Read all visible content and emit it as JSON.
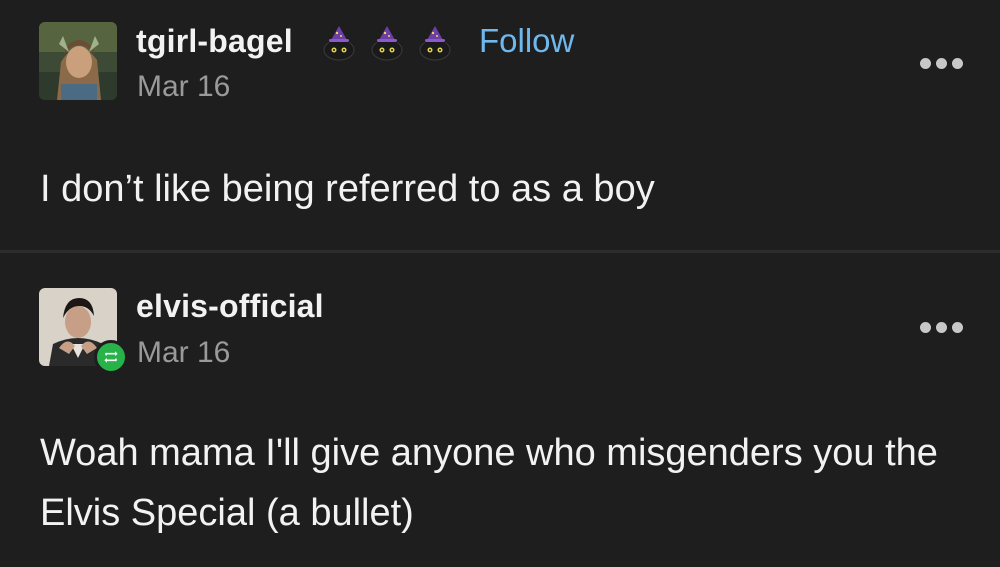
{
  "posts": [
    {
      "username": "tgirl-bagel",
      "badges": [
        "witch-cat-badge-icon",
        "witch-cat-badge-icon",
        "witch-cat-badge-icon"
      ],
      "follow_label": "Follow",
      "date": "Mar 16",
      "text": "I don’t like being referred to as a boy"
    },
    {
      "username": "elvis-official",
      "date": "Mar 16",
      "text": "Woah mama I'll give anyone who misgenders you the Elvis Special (a bullet)"
    }
  ],
  "colors": {
    "background": "#1e1e1e",
    "follow": "#6fb8ee",
    "reblog": "#27b24a",
    "date": "#9a9a9a"
  }
}
